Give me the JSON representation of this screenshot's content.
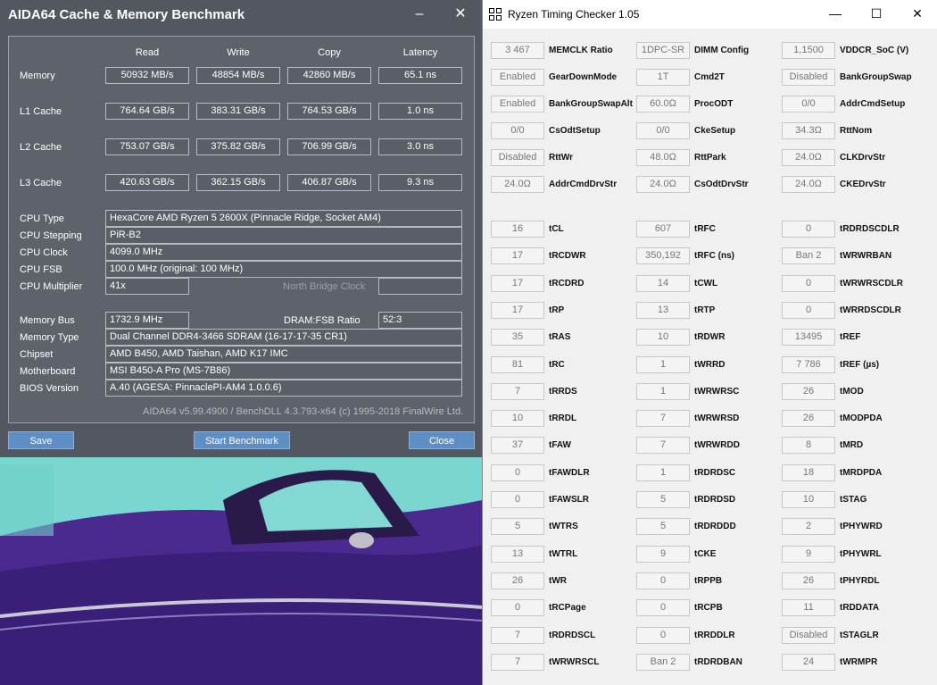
{
  "aida": {
    "title": "AIDA64 Cache & Memory Benchmark",
    "minimize": "–",
    "close": "✕",
    "columns": [
      "Read",
      "Write",
      "Copy",
      "Latency"
    ],
    "bench": [
      {
        "label": "Memory",
        "values": [
          "50932 MB/s",
          "48854 MB/s",
          "42860 MB/s",
          "65.1 ns"
        ]
      },
      {
        "label": "L1 Cache",
        "values": [
          "764.64 GB/s",
          "383.31 GB/s",
          "764.53 GB/s",
          "1.0 ns"
        ]
      },
      {
        "label": "L2 Cache",
        "values": [
          "753.07 GB/s",
          "375.82 GB/s",
          "706.99 GB/s",
          "3.0 ns"
        ]
      },
      {
        "label": "L3 Cache",
        "values": [
          "420.63 GB/s",
          "362.15 GB/s",
          "406.87 GB/s",
          "9.3 ns"
        ]
      }
    ],
    "info": [
      {
        "label": "CPU Type",
        "value": "HexaCore AMD Ryzen 5 2600X  (Pinnacle Ridge, Socket AM4)"
      },
      {
        "label": "CPU Stepping",
        "value": "PiR-B2"
      },
      {
        "label": "CPU Clock",
        "value": "4099.0 MHz"
      },
      {
        "label": "CPU FSB",
        "value": "100.0 MHz  (original: 100 MHz)"
      },
      {
        "label": "CPU Multiplier",
        "value": "41x"
      }
    ],
    "nb_clock_label": "North Bridge Clock",
    "mem_bus_label": "Memory Bus",
    "mem_bus_value": "1732.9 MHz",
    "dram_fsb_label": "DRAM:FSB Ratio",
    "dram_fsb_value": "52:3",
    "info2": [
      {
        "label": "Memory Type",
        "value": "Dual Channel DDR4-3466 SDRAM  (16-17-17-35 CR1)"
      },
      {
        "label": "Chipset",
        "value": "AMD B450, AMD Taishan, AMD K17 IMC"
      },
      {
        "label": "Motherboard",
        "value": "MSI B450-A Pro (MS-7B86)"
      },
      {
        "label": "BIOS Version",
        "value": "A.40  (AGESA: PinnaclePI-AM4 1.0.0.6)"
      }
    ],
    "footer": "AIDA64 v5.99.4900 / BenchDLL 4.3.793-x64  (c) 1995-2018 FinalWire Ltd.",
    "btn_save": "Save",
    "btn_start": "Start Benchmark",
    "btn_close": "Close"
  },
  "rtc": {
    "title": "Ryzen Timing Checker 1.05",
    "minimize": "—",
    "maximize": "☐",
    "close": "✕",
    "top": [
      [
        {
          "v": "3 467",
          "l": "MEMCLK Ratio"
        },
        {
          "v": "1DPC-SR",
          "l": "DIMM Config"
        },
        {
          "v": "1,1500",
          "l": "VDDCR_SoC (V)"
        }
      ],
      [
        {
          "v": "Enabled",
          "l": "GearDownMode"
        },
        {
          "v": "1T",
          "l": "Cmd2T"
        },
        {
          "v": "Disabled",
          "l": "BankGroupSwap"
        }
      ],
      [
        {
          "v": "Enabled",
          "l": "BankGroupSwapAlt"
        },
        {
          "v": "60.0Ω",
          "l": "ProcODT"
        },
        {
          "v": "0/0",
          "l": "AddrCmdSetup"
        }
      ],
      [
        {
          "v": "0/0",
          "l": "CsOdtSetup"
        },
        {
          "v": "0/0",
          "l": "CkeSetup"
        },
        {
          "v": "34.3Ω",
          "l": "RttNom"
        }
      ],
      [
        {
          "v": "Disabled",
          "l": "RttWr"
        },
        {
          "v": "48.0Ω",
          "l": "RttPark"
        },
        {
          "v": "24.0Ω",
          "l": "CLKDrvStr"
        }
      ],
      [
        {
          "v": "24.0Ω",
          "l": "AddrCmdDrvStr"
        },
        {
          "v": "24.0Ω",
          "l": "CsOdtDrvStr"
        },
        {
          "v": "24.0Ω",
          "l": "CKEDrvStr"
        }
      ]
    ],
    "timings": [
      [
        {
          "v": "16",
          "l": "tCL"
        },
        {
          "v": "607",
          "l": "tRFC"
        },
        {
          "v": "0",
          "l": "tRDRDSCDLR"
        }
      ],
      [
        {
          "v": "17",
          "l": "tRCDWR"
        },
        {
          "v": "350,192",
          "l": "tRFC (ns)"
        },
        {
          "v": "Ban 2",
          "l": "tWRWRBAN"
        }
      ],
      [
        {
          "v": "17",
          "l": "tRCDRD"
        },
        {
          "v": "14",
          "l": "tCWL"
        },
        {
          "v": "0",
          "l": "tWRWRSCDLR"
        }
      ],
      [
        {
          "v": "17",
          "l": "tRP"
        },
        {
          "v": "13",
          "l": "tRTP"
        },
        {
          "v": "0",
          "l": "tWRRDSCDLR"
        }
      ],
      [
        {
          "v": "35",
          "l": "tRAS"
        },
        {
          "v": "10",
          "l": "tRDWR"
        },
        {
          "v": "13495",
          "l": "tREF"
        }
      ],
      [
        {
          "v": "81",
          "l": "tRC"
        },
        {
          "v": "1",
          "l": "tWRRD"
        },
        {
          "v": "7 786",
          "l": "tREF (µs)"
        }
      ],
      [
        {
          "v": "7",
          "l": "tRRDS"
        },
        {
          "v": "1",
          "l": "tWRWRSC"
        },
        {
          "v": "26",
          "l": "tMOD"
        }
      ],
      [
        {
          "v": "10",
          "l": "tRRDL"
        },
        {
          "v": "7",
          "l": "tWRWRSD"
        },
        {
          "v": "26",
          "l": "tMODPDA"
        }
      ],
      [
        {
          "v": "37",
          "l": "tFAW"
        },
        {
          "v": "7",
          "l": "tWRWRDD"
        },
        {
          "v": "8",
          "l": "tMRD"
        }
      ],
      [
        {
          "v": "0",
          "l": "tFAWDLR"
        },
        {
          "v": "1",
          "l": "tRDRDSC"
        },
        {
          "v": "18",
          "l": "tMRDPDA"
        }
      ],
      [
        {
          "v": "0",
          "l": "tFAWSLR"
        },
        {
          "v": "5",
          "l": "tRDRDSD"
        },
        {
          "v": "10",
          "l": "tSTAG"
        }
      ],
      [
        {
          "v": "5",
          "l": "tWTRS"
        },
        {
          "v": "5",
          "l": "tRDRDDD"
        },
        {
          "v": "2",
          "l": "tPHYWRD"
        }
      ],
      [
        {
          "v": "13",
          "l": "tWTRL"
        },
        {
          "v": "9",
          "l": "tCKE"
        },
        {
          "v": "9",
          "l": "tPHYWRL"
        }
      ],
      [
        {
          "v": "26",
          "l": "tWR"
        },
        {
          "v": "0",
          "l": "tRPPB"
        },
        {
          "v": "26",
          "l": "tPHYRDL"
        }
      ],
      [
        {
          "v": "0",
          "l": "tRCPage"
        },
        {
          "v": "0",
          "l": "tRCPB"
        },
        {
          "v": "11",
          "l": "tRDDATA"
        }
      ],
      [
        {
          "v": "7",
          "l": "tRDRDSCL"
        },
        {
          "v": "0",
          "l": "tRRDDLR"
        },
        {
          "v": "Disabled",
          "l": "tSTAGLR"
        }
      ],
      [
        {
          "v": "7",
          "l": "tWRWRSCL"
        },
        {
          "v": "Ban 2",
          "l": "tRDRDBAN"
        },
        {
          "v": "24",
          "l": "tWRMPR"
        }
      ]
    ]
  }
}
